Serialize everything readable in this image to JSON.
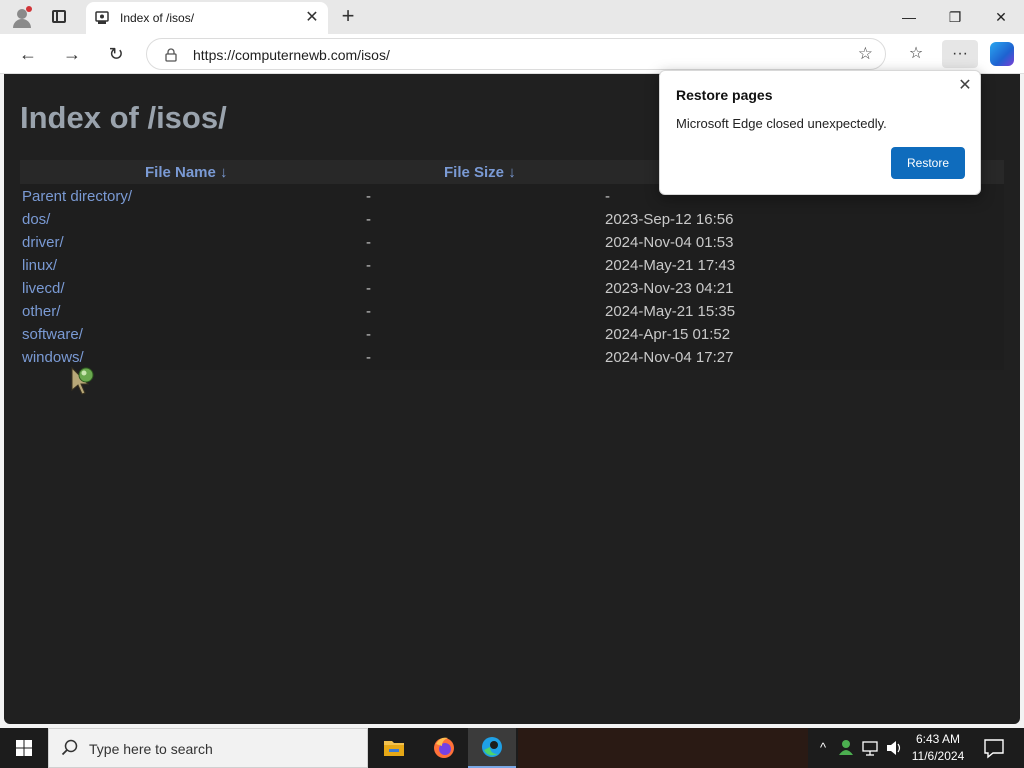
{
  "browser": {
    "tab_title": "Index of /isos/",
    "url": "https://computernewb.com/isos/",
    "window_controls": {
      "minimize": "—",
      "restore": "❐",
      "close": "✕"
    }
  },
  "page": {
    "heading": "Index of /isos/",
    "columns": {
      "name": "File Name  ↓",
      "size": "File Size  ↓"
    },
    "rows": [
      {
        "name": "Parent directory/",
        "size": "-",
        "date": "-"
      },
      {
        "name": "dos/",
        "size": "-",
        "date": "2023-Sep-12 16:56"
      },
      {
        "name": "driver/",
        "size": "-",
        "date": "2024-Nov-04 01:53"
      },
      {
        "name": "linux/",
        "size": "-",
        "date": "2024-May-21 17:43"
      },
      {
        "name": "livecd/",
        "size": "-",
        "date": "2023-Nov-23 04:21"
      },
      {
        "name": "other/",
        "size": "-",
        "date": "2024-May-21 15:35"
      },
      {
        "name": "software/",
        "size": "-",
        "date": "2024-Apr-15 01:52"
      },
      {
        "name": "windows/",
        "size": "-",
        "date": "2024-Nov-04 17:27"
      }
    ]
  },
  "popup": {
    "title": "Restore pages",
    "message": "Microsoft Edge closed unexpectedly.",
    "button": "Restore"
  },
  "taskbar": {
    "search_placeholder": "Type here to search",
    "time": "6:43 AM",
    "date": "11/6/2024"
  },
  "colors": {
    "accent": "#0f6cbd",
    "link": "#7a9ad4",
    "page_bg": "#202020"
  }
}
